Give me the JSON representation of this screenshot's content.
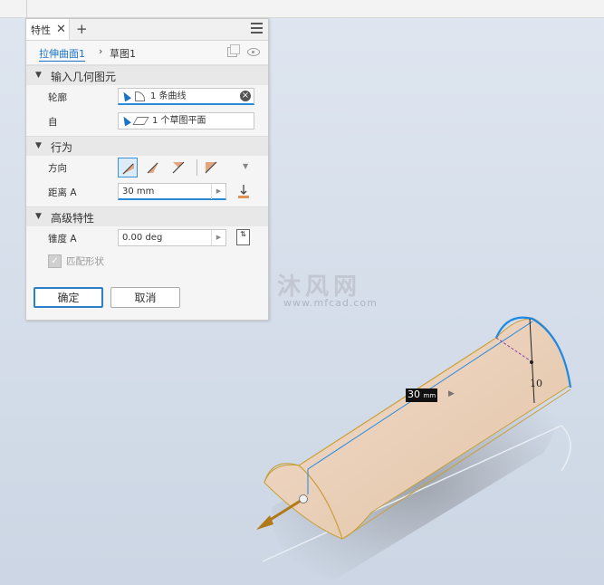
{
  "panel": {
    "tab_label": "特性",
    "breadcrumb": {
      "feature": "拉伸曲面1",
      "sketch": "草图1"
    },
    "sections": {
      "input_geometry": {
        "title": "输入几何图元",
        "profile_label": "轮廓",
        "profile_value": "1 条曲线",
        "from_label": "自",
        "from_value": "1 个草图平面"
      },
      "behavior": {
        "title": "行为",
        "direction_label": "方向",
        "distance_label": "距离 A",
        "distance_value": "30 mm"
      },
      "advanced": {
        "title": "高级特性",
        "taper_label": "锥度 A",
        "taper_value": "0.00 deg",
        "match_shape_label": "匹配形状",
        "match_shape_checked": true
      }
    },
    "ok_label": "确定",
    "cancel_label": "取消"
  },
  "viewport": {
    "dimension_value": "30",
    "dimension_unit": "mm",
    "radius_label": "10"
  },
  "watermark": {
    "text": "沐风网",
    "url": "www.mfcad.com"
  },
  "colors": {
    "accent": "#2a8ad6",
    "surface_fill": "#ecd3bb",
    "edge_yellow": "#c8a03a",
    "sketch_blue": "#1e88e5",
    "arrow_gold": "#b07a18"
  }
}
